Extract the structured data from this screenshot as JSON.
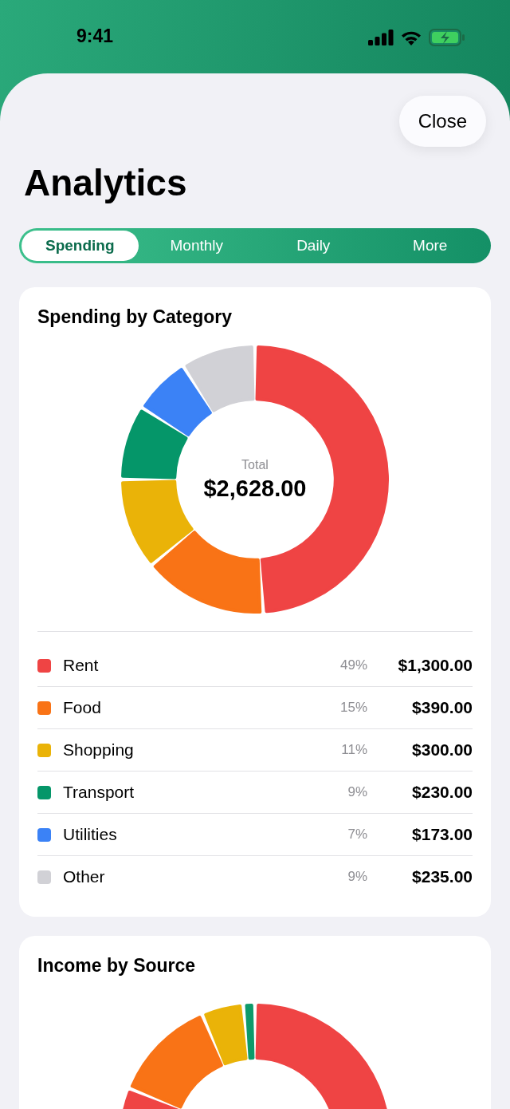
{
  "status_bar": {
    "time": "9:41"
  },
  "close_button": {
    "label": "Close"
  },
  "title": "Analytics",
  "tabs": [
    {
      "label": "Spending",
      "selected": true
    },
    {
      "label": "Monthly",
      "selected": false
    },
    {
      "label": "Daily",
      "selected": false
    },
    {
      "label": "More",
      "selected": false
    }
  ],
  "spending_card": {
    "title": "Spending by Category",
    "total_label": "Total",
    "total_value": "$2,628.00",
    "chart_data": {
      "type": "donut",
      "categories": [
        "Rent",
        "Food",
        "Shopping",
        "Transport",
        "Utilities",
        "Other"
      ],
      "values": [
        49,
        15,
        11,
        9,
        7,
        9
      ]
    },
    "legend": [
      {
        "color": "#ef4444",
        "percent": "49%",
        "amount": "$1,300.00"
      },
      {
        "color": "#f97316",
        "percent": "15%",
        "amount": "$390.00"
      },
      {
        "color": "#eab308",
        "percent": "11%",
        "amount": "$300.00"
      },
      {
        "color": "#059669",
        "percent": "9%",
        "amount": "$230.00"
      },
      {
        "color": "#3b82f6",
        "percent": "7%",
        "amount": "$173.00"
      },
      {
        "color": "#d1d1d6",
        "percent": "9%",
        "amount": "$235.00"
      }
    ]
  },
  "income_card": {
    "title": "Income by Source"
  }
}
